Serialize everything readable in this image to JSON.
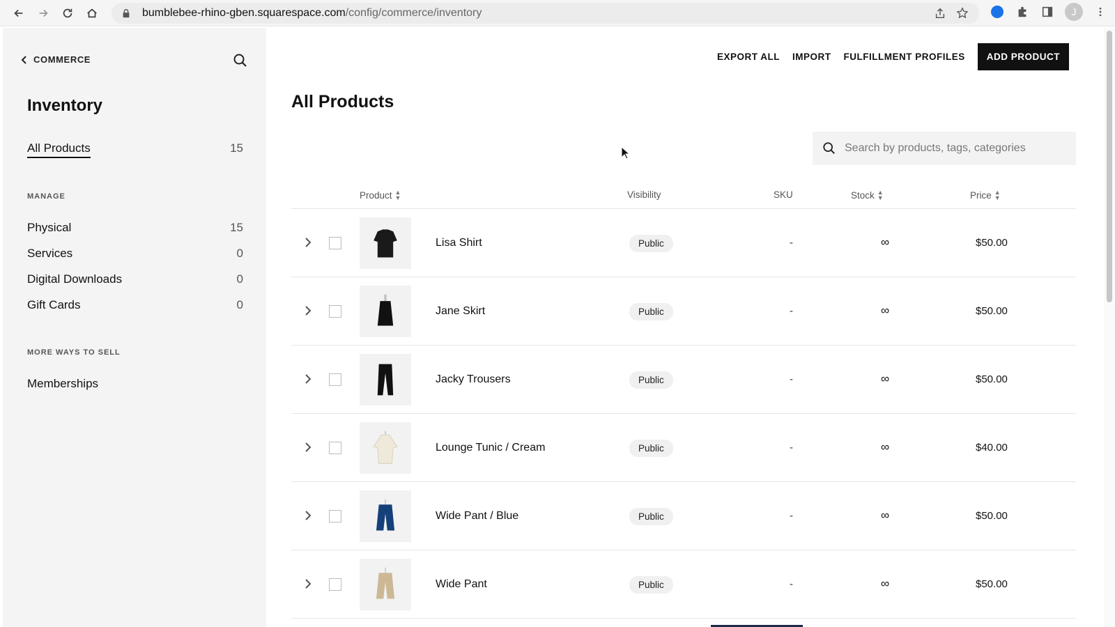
{
  "browser": {
    "url_host": "bumblebee-rhino-gben.squarespace.com",
    "url_path": "/config/commerce/inventory",
    "avatar_initial": "J"
  },
  "sidebar": {
    "back_label": "COMMERCE",
    "title": "Inventory",
    "all_products": {
      "label": "All Products",
      "count": "15"
    },
    "manage_heading": "MANAGE",
    "manage_items": [
      {
        "label": "Physical",
        "count": "15"
      },
      {
        "label": "Services",
        "count": "0"
      },
      {
        "label": "Digital Downloads",
        "count": "0"
      },
      {
        "label": "Gift Cards",
        "count": "0"
      }
    ],
    "more_heading": "MORE WAYS TO SELL",
    "more_items": [
      {
        "label": "Memberships"
      }
    ]
  },
  "toolbar": {
    "export_label": "EXPORT ALL",
    "import_label": "IMPORT",
    "fulfillment_label": "FULFILLMENT PROFILES",
    "add_label": "ADD PRODUCT"
  },
  "main": {
    "title": "All Products",
    "search_placeholder": "Search by products, tags, categories"
  },
  "table": {
    "columns": {
      "product": "Product",
      "visibility": "Visibility",
      "sku": "SKU",
      "stock": "Stock",
      "price": "Price"
    },
    "rows": [
      {
        "name": "Lisa Shirt",
        "visibility": "Public",
        "sku": "-",
        "stock": "∞",
        "price": "$50.00",
        "thumb": "shirt-dark"
      },
      {
        "name": "Jane Skirt",
        "visibility": "Public",
        "sku": "-",
        "stock": "∞",
        "price": "$50.00",
        "thumb": "skirt-dark"
      },
      {
        "name": "Jacky Trousers",
        "visibility": "Public",
        "sku": "-",
        "stock": "∞",
        "price": "$50.00",
        "thumb": "trousers-dark"
      },
      {
        "name": "Lounge Tunic / Cream",
        "visibility": "Public",
        "sku": "-",
        "stock": "∞",
        "price": "$40.00",
        "thumb": "tunic-cream"
      },
      {
        "name": "Wide Pant / Blue",
        "visibility": "Public",
        "sku": "-",
        "stock": "∞",
        "price": "$50.00",
        "thumb": "pant-blue"
      },
      {
        "name": "Wide Pant",
        "visibility": "Public",
        "sku": "-",
        "stock": "∞",
        "price": "$50.00",
        "thumb": "pant-tan"
      }
    ]
  },
  "colors": {
    "primary_button": "#111111",
    "sidebar_bg": "#f4f4f4",
    "badge_bg": "#f0f0f0"
  }
}
